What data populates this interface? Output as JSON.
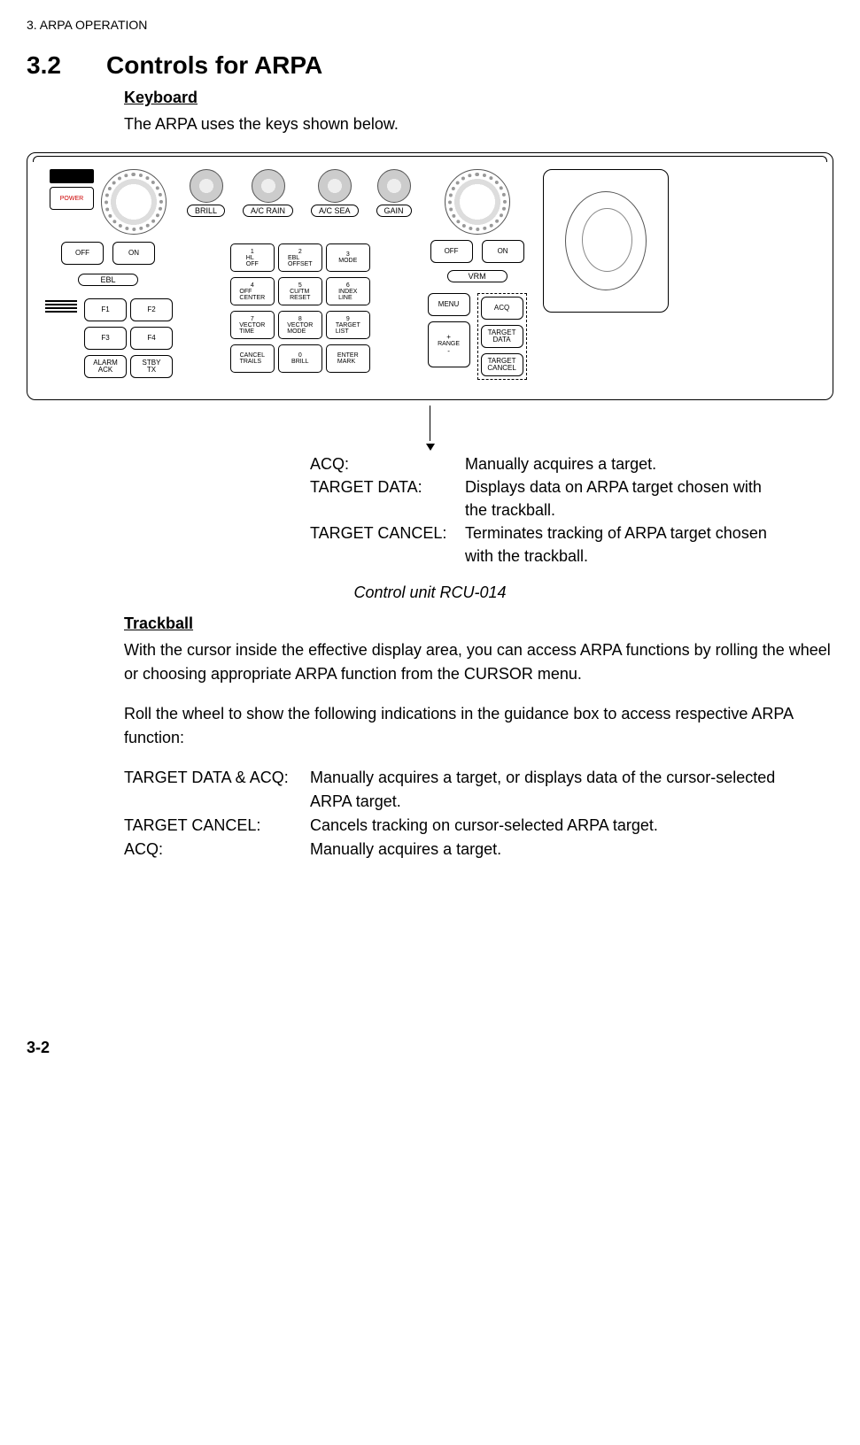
{
  "header": "3. ARPA OPERATION",
  "section": {
    "number": "3.2",
    "title": "Controls for ARPA"
  },
  "sub_keyboard": "Keyboard",
  "intro_keyboard": "The ARPA uses the keys shown below.",
  "panel": {
    "power": "POWER",
    "knob_labels": {
      "brill": "BRILL",
      "ac_rain": "A/C RAIN",
      "ac_sea": "A/C SEA",
      "gain": "GAIN"
    },
    "ebl": {
      "off": "OFF",
      "on": "ON",
      "ebl": "EBL"
    },
    "vrm": {
      "off": "OFF",
      "on": "ON",
      "vrm": "VRM"
    },
    "f_keys": {
      "f1": "F1",
      "f2": "F2",
      "f3": "F3",
      "f4": "F4",
      "alarm": "ALARM\nACK",
      "stby": "STBY\nTX"
    },
    "keypad": {
      "k1": {
        "n": "1",
        "t": "HL\nOFF"
      },
      "k2": {
        "n": "2",
        "t": "EBL\nOFFSET"
      },
      "k3": {
        "n": "3",
        "t": "MODE"
      },
      "k4": {
        "n": "4",
        "t": "OFF\nCENTER"
      },
      "k5": {
        "n": "5",
        "t": "CU/TM\nRESET"
      },
      "k6": {
        "n": "6",
        "t": "INDEX\nLINE"
      },
      "k7": {
        "n": "7",
        "t": "VECTOR\nTIME"
      },
      "k8": {
        "n": "8",
        "t": "VECTOR\nMODE"
      },
      "k9": {
        "n": "9",
        "t": "TARGET\nLIST"
      },
      "kc": {
        "n": "",
        "t": "CANCEL\nTRAILS"
      },
      "k0": {
        "n": "0",
        "t": "BRILL"
      },
      "ke": {
        "n": "",
        "t": "ENTER\nMARK"
      }
    },
    "right": {
      "menu": "MENU",
      "range_plus": "+",
      "range_lbl": "RANGE",
      "range_minus": "-"
    },
    "arpa": {
      "acq": "ACQ",
      "target_data": "TARGET\nDATA",
      "target_cancel": "TARGET\nCANCEL"
    }
  },
  "callouts": {
    "acq_k": "ACQ:",
    "acq_v": "Manually acquires a target.",
    "td_k": "TARGET DATA:",
    "td_v": "Displays data on ARPA target chosen with the trackball.",
    "tc_k": "TARGET CANCEL:",
    "tc_v": "Terminates tracking of ARPA target chosen with the trackball."
  },
  "fig_caption": "Control unit RCU-014",
  "sub_trackball": "Trackball",
  "para_trackball_1": "With the cursor inside the effective display area, you can access ARPA functions by rolling the wheel or choosing appropriate ARPA function from the CURSOR menu.",
  "para_trackball_2": "Roll the wheel to show the following indications in the guidance box to access respective ARPA function:",
  "defs": {
    "tda_k": "TARGET DATA & ACQ:",
    "tda_v": "Manually acquires a target, or displays data of the cursor-selected ARPA target.",
    "tc2_k": "TARGET CANCEL:",
    "tc2_v": "Cancels tracking on cursor-selected ARPA target.",
    "acq2_k": "ACQ:",
    "acq2_v": "Manually acquires a target."
  },
  "page_num": "3-2"
}
